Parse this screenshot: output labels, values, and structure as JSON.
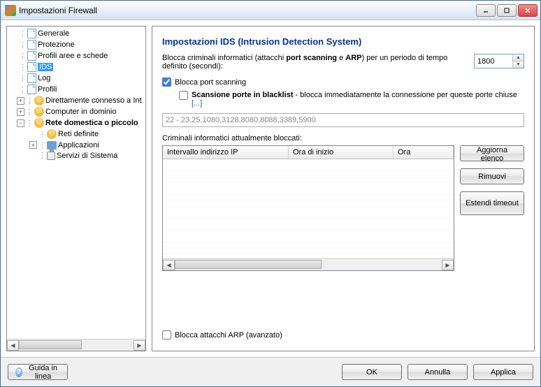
{
  "window": {
    "title": "Impostazioni Firewall"
  },
  "sidebar": {
    "items": [
      {
        "label": "Generale"
      },
      {
        "label": "Protezione"
      },
      {
        "label": "Profili aree e schede"
      },
      {
        "label": "IDS"
      },
      {
        "label": "Log"
      },
      {
        "label": "Profili"
      },
      {
        "label": "Direttamente connesso a Int"
      },
      {
        "label": "Computer in dominio"
      },
      {
        "label": "Rete domestica o piccolo"
      },
      {
        "label": "Reti definite"
      },
      {
        "label": "Applicazioni"
      },
      {
        "label": "Servizi di Sistema"
      }
    ]
  },
  "main": {
    "heading": "Impostazioni IDS (Intrusion Detection System)",
    "desc_pre": "Blocca criminali informatici (attacchi ",
    "desc_b1": "port scanning",
    "desc_mid": " e ",
    "desc_b2": "ARP",
    "desc_post": ") per un periodo di tempo definito (secondi):",
    "timeout_value": "1800",
    "chk_portscan": "Blocca port scanning",
    "blacklist_b": "Scansione porte in blacklist",
    "blacklist_rest": " - blocca immediatamente la connessione per queste porte chiuse ",
    "blacklist_dots": "[...]",
    "ports_value": "22 - 23,25,1080,3128,8080,8088,3389,5900",
    "blocked_label": "Criminali informatici attualmente bloccati:",
    "columns": {
      "ip": "Intervallo indirizzo IP",
      "start": "Ora di inizio",
      "ora": "Ora"
    },
    "buttons": {
      "refresh": "Aggiorna elenco",
      "remove": "Rimuovi",
      "extend": "Estendi timeout"
    },
    "chk_arp": "Blocca attacchi ARP (avanzato)"
  },
  "footer": {
    "help": "Guida in linea",
    "ok": "OK",
    "cancel": "Annulla",
    "apply": "Applica"
  }
}
